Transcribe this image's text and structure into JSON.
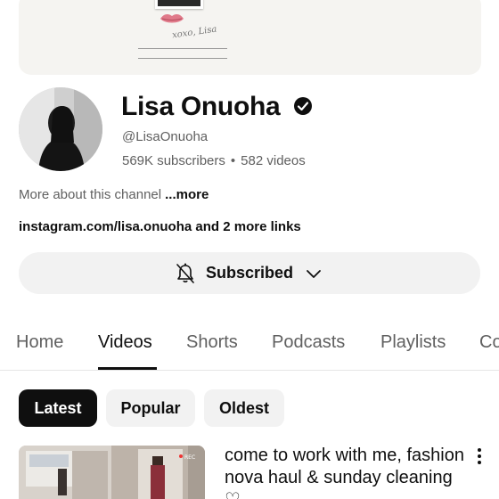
{
  "banner": {
    "signature": "xoxo, Lisa"
  },
  "channel": {
    "name": "Lisa Onuoha",
    "handle": "@LisaOnuoha",
    "subscribers": "569K subscribers",
    "separator": "•",
    "videos": "582 videos",
    "about_text": "More about this channel",
    "about_more": "...more",
    "links_main": "instagram.com/lisa.onuoha",
    "links_more": " and 2 more links"
  },
  "subscribe": {
    "label": "Subscribed",
    "icon": "bell-off-icon",
    "caret_icon": "chevron-down-icon"
  },
  "tabs": [
    {
      "label": "Home",
      "active": false
    },
    {
      "label": "Videos",
      "active": true
    },
    {
      "label": "Shorts",
      "active": false
    },
    {
      "label": "Podcasts",
      "active": false
    },
    {
      "label": "Playlists",
      "active": false
    },
    {
      "label": "Co",
      "active": false
    }
  ],
  "chips": [
    {
      "label": "Latest",
      "active": true
    },
    {
      "label": "Popular",
      "active": false
    },
    {
      "label": "Oldest",
      "active": false
    }
  ],
  "video": {
    "title": "come to work with me, fashion nova haul & sunday cleaning ♡",
    "menu_icon": "more-vert-icon"
  },
  "colors": {
    "text_primary": "#0f0f0f",
    "text_secondary": "#606060",
    "chip_bg": "#f2f2f2",
    "chip_active_bg": "#0f0f0f",
    "divider": "#e5e5e5"
  }
}
